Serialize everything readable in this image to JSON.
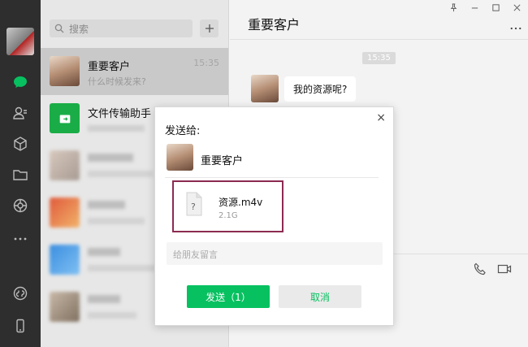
{
  "app": {
    "accent_color": "#07c160",
    "nav_icons": [
      "chat-icon",
      "contacts-icon",
      "favorites-icon",
      "folder-icon",
      "moments-icon",
      "more-icon",
      "miniprogram-icon",
      "phone-icon"
    ]
  },
  "search": {
    "placeholder": "搜索"
  },
  "chats": [
    {
      "name": "重要客户",
      "preview": "什么时候发来?",
      "time": "15:35"
    },
    {
      "name": "文件传输助手",
      "preview": "",
      "time": ""
    }
  ],
  "main": {
    "title": "重要客户",
    "timestamp": "15:35",
    "message": "我的资源呢?"
  },
  "dialog": {
    "title": "发送给:",
    "recipient": "重要客户",
    "file": {
      "name": "资源.m4v",
      "size": "2.1G",
      "icon_glyph": "?"
    },
    "remark_placeholder": "给朋友留言",
    "send_label": "发送（1）",
    "cancel_label": "取消",
    "close_glyph": "×"
  }
}
